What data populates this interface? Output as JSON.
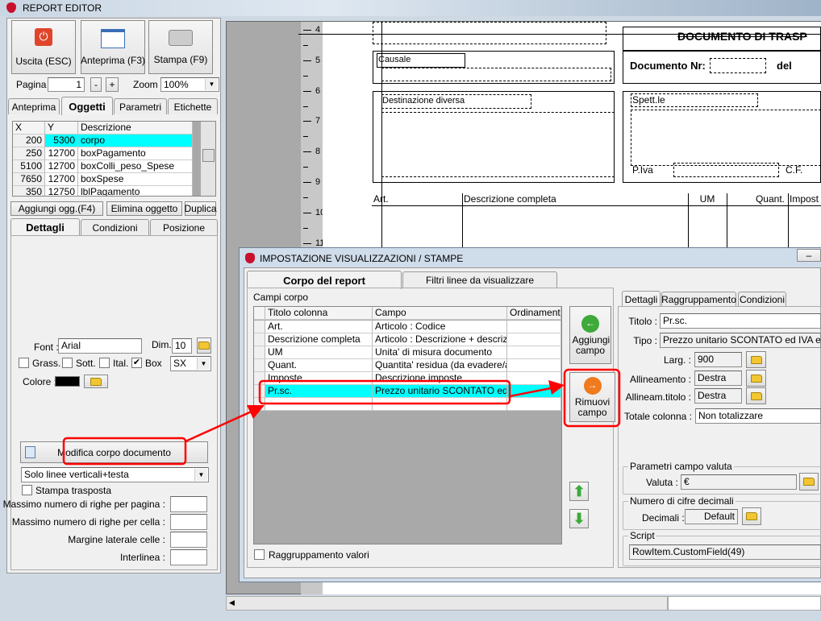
{
  "app": {
    "title": "REPORT EDITOR"
  },
  "toolbar": {
    "exit": "Uscita (ESC)",
    "preview": "Anteprima (F3)",
    "print": "Stampa (F9)",
    "page_label": "Pagina",
    "page_value": "1",
    "minus": "-",
    "plus": "+",
    "zoom_label": "Zoom",
    "zoom_value": "100%"
  },
  "left_tabs": [
    "Anteprima",
    "Oggetti",
    "Parametri",
    "Etichette"
  ],
  "objects_table": {
    "headers": [
      "X",
      "Y",
      "Descrizione"
    ],
    "rows": [
      [
        "200",
        "5300",
        "corpo"
      ],
      [
        "250",
        "12700",
        "boxPagamento"
      ],
      [
        "5100",
        "12700",
        "boxColli_peso_Spese"
      ],
      [
        "7650",
        "12700",
        "boxSpese"
      ],
      [
        "350",
        "12750",
        "lblPagamento"
      ]
    ],
    "selected_color": "#00ffff"
  },
  "object_buttons": {
    "add": "Aggiungi ogg.(F4)",
    "delete": "Elimina oggetto",
    "duplicate": "Duplica"
  },
  "sub_tabs": [
    "Dettagli",
    "Condizioni",
    "Posizione"
  ],
  "font": {
    "label": "Font :",
    "value": "Arial",
    "dim_label": "Dim.",
    "dim_value": "10",
    "bold": "Grass.",
    "underline": "Sott.",
    "italic": "Ital.",
    "box": "Box",
    "box_checked": true,
    "align_value": "SX",
    "color_label": "Colore :",
    "color": "#000000"
  },
  "body_section": {
    "edit_button": "Modifica corpo documento",
    "lines_select": "Solo linee verticali+testa",
    "transposed": "Stampa trasposta",
    "max_rows_page": "Massimo numero di righe per pagina :",
    "max_rows_cell": "Massimo numero di righe per cella :",
    "cell_margin": "Margine laterale celle :",
    "line_spacing": "Interlinea :"
  },
  "ruler": [
    "4",
    "5",
    "6",
    "7",
    "8",
    "9",
    "10",
    "11"
  ],
  "document": {
    "title": "DOCUMENTO DI TRASP",
    "causale": "Causale",
    "doc_nr": "Documento Nr:",
    "del": "del",
    "destinazione": "Destinazione diversa",
    "spett": "Spett.le",
    "piva": "P.Iva",
    "cf": "C.F.",
    "columns": [
      "Art.",
      "Descrizione completa",
      "UM",
      "Quant.",
      "Impost"
    ]
  },
  "dialog": {
    "title": "IMPOSTAZIONE VISUALIZZAZIONI / STAMPE",
    "tabs": [
      "Corpo del report",
      "Filtri linee da visualizzare"
    ],
    "fields_label": "Campi corpo",
    "grid_headers": [
      "Titolo colonna",
      "Campo",
      "Ordinamento"
    ],
    "rows": [
      [
        "Art.",
        "Articolo : Codice",
        ""
      ],
      [
        "Descrizione completa",
        "Articolo : Descrizione + descrizio...",
        ""
      ],
      [
        "UM",
        "Unita' di misura documento",
        ""
      ],
      [
        "Quant.",
        "Quantita' residua (da evadere/a...",
        ""
      ],
      [
        "Imposte",
        "Descrizione imposte",
        ""
      ],
      [
        "Pr.sc.",
        "Prezzo unitario SCONTATO ed I...",
        ""
      ]
    ],
    "add_field": "Aggiungi campo",
    "remove_field": "Rimuovi campo",
    "group_values": "Raggruppamento valori",
    "detail_tabs": [
      "Dettagli",
      "Raggruppamento",
      "Condizioni"
    ],
    "titolo_label": "Titolo :",
    "titolo": "Pr.sc.",
    "tipo_label": "Tipo :",
    "tipo": "Prezzo unitario SCONTATO ed IVA esclusa",
    "larg_label": "Larg. :",
    "larg": "900",
    "align_label": "Allineamento :",
    "align": "Destra",
    "align_title_label": "Allineam.titolo :",
    "align_title": "Destra",
    "total_label": "Totale colonna :",
    "total": "Non totalizzare",
    "currency_group": "Parametri campo valuta",
    "currency_label": "Valuta :",
    "currency": "€",
    "decimals_group": "Numero di cifre decimali",
    "decimals_label": "Decimali :",
    "decimals": "Default",
    "script_group": "Script",
    "script": "RowItem.CustomField(49)"
  },
  "highlight_color": "#ff0000"
}
